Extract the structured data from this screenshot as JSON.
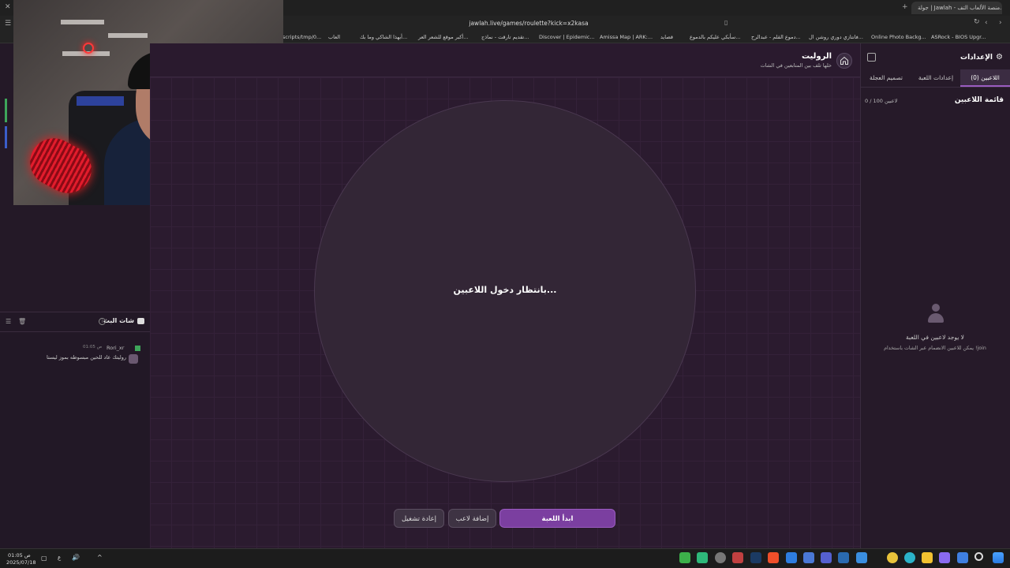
{
  "browser": {
    "tab_title": "جولة | Jawlah - منصة الألعاب التف...",
    "url": "jawlah.live/games/roulette?kick=x2kasa",
    "bookmarks": [
      "ASRock - BIOS Upgr...",
      "Online Photo Backg...",
      "فانتازي دوري روشن ال...",
      "دموع القلم - عبدالرح...",
      "سأبكي عليكم بالدموع...",
      "قصايد",
      "Amissa Map | ARK:...",
      "Discover | Epidemic...",
      "تقديم تارقت - نماذج...",
      "أكبر موقع للشعر العر...",
      "أبهذا الشاكي وما بك...",
      "العاب",
      "scripts/tmp/0..."
    ],
    "colors": {
      "accent": "#7b3fa0"
    }
  },
  "header": {
    "title": "الروليت",
    "subtitle": "خلها تلف بين المتابعين في الشات",
    "home_icon": "home-icon"
  },
  "wheel": {
    "status": "بانتظار دخول اللاعبين..."
  },
  "actions": {
    "start": "ابدأ اللعبة",
    "add_player": "إضافة لاعب",
    "restart": "إعادة تشغيل"
  },
  "settings": {
    "title": "الإعدادات",
    "tabs": [
      "اللاعبين (0)",
      "إعدادات اللعبة",
      "تصميم العجلة"
    ],
    "players_title": "قائمة اللاعبين",
    "players_count": "0 / 100 لاعبين",
    "empty_title": "لا يوجد لاعبين في اللعبة",
    "empty_hint": "يمكن للاعبين الانضمام عبر الشات باستخدام !join"
  },
  "chat": {
    "title": "شات البث",
    "messages": [
      {
        "user": "Rori_xr",
        "time": "01:05 ص",
        "text": "روليتك عاد للحين مبسوطه بموز ليستا"
      }
    ]
  },
  "taskbar": {
    "time": "01:05 ص",
    "date": "2025/07/18",
    "lang": "ع"
  }
}
